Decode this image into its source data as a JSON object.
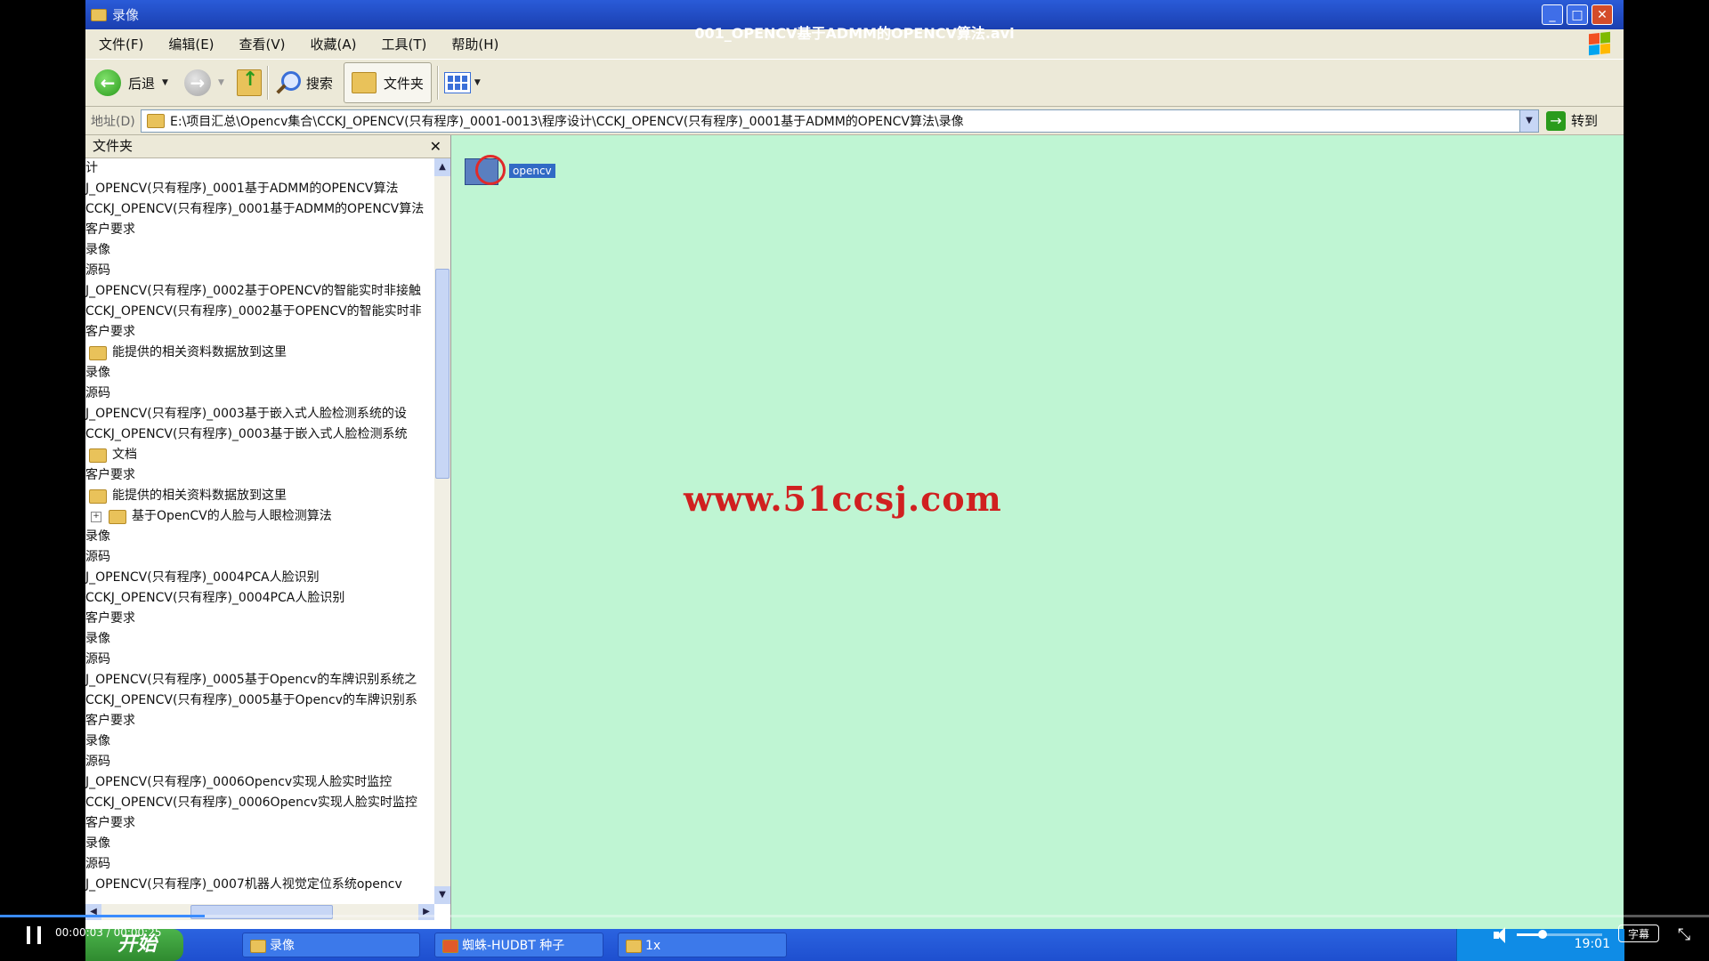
{
  "video": {
    "title": "001_OPENCV基于ADMM的OPENCV算法.avi",
    "current_time": "00:00:03",
    "duration": "00:00:25",
    "progress_fraction": 0.12,
    "volume_fraction": 0.3,
    "subtitle_label": "字幕"
  },
  "window": {
    "title": "录像",
    "min_glyph": "_",
    "max_glyph": "□",
    "close_glyph": "✕"
  },
  "menu": [
    "文件(F)",
    "编辑(E)",
    "查看(V)",
    "收藏(A)",
    "工具(T)",
    "帮助(H)"
  ],
  "toolbar": {
    "back_label": "后退",
    "search_label": "搜索",
    "folders_label": "文件夹"
  },
  "address": {
    "label": "地址(D)",
    "path": "E:\\项目汇总\\Opencv集合\\CCKJ_OPENCV(只有程序)_0001-0013\\程序设计\\CCKJ_OPENCV(只有程序)_0001基于ADMM的OPENCV算法\\录像",
    "go_label": "转到"
  },
  "folders_pane": {
    "title": "文件夹",
    "close_glyph": "✕",
    "items": [
      {
        "text": "计",
        "icon": "none"
      },
      {
        "text": "J_OPENCV(只有程序)_0001基于ADMM的OPENCV算法",
        "icon": "none"
      },
      {
        "text": "CCKJ_OPENCV(只有程序)_0001基于ADMM的OPENCV算法",
        "icon": "none"
      },
      {
        "text": "客户要求",
        "icon": "none"
      },
      {
        "text": "录像",
        "icon": "none"
      },
      {
        "text": "源码",
        "icon": "none"
      },
      {
        "text": "J_OPENCV(只有程序)_0002基于OPENCV的智能实时非接触",
        "icon": "none"
      },
      {
        "text": "CCKJ_OPENCV(只有程序)_0002基于OPENCV的智能实时非",
        "icon": "none"
      },
      {
        "text": "客户要求",
        "icon": "none"
      },
      {
        "text": "能提供的相关资料数据放到这里",
        "icon": "folder"
      },
      {
        "text": "录像",
        "icon": "none"
      },
      {
        "text": "源码",
        "icon": "none"
      },
      {
        "text": "J_OPENCV(只有程序)_0003基于嵌入式人脸检测系统的设",
        "icon": "none"
      },
      {
        "text": "CCKJ_OPENCV(只有程序)_0003基于嵌入式人脸检测系统",
        "icon": "none"
      },
      {
        "text": "文档",
        "icon": "folder"
      },
      {
        "text": "客户要求",
        "icon": "none"
      },
      {
        "text": "能提供的相关资料数据放到这里",
        "icon": "folder"
      },
      {
        "text": "基于OpenCV的人脸与人眼检测算法",
        "icon": "plus-folder"
      },
      {
        "text": "录像",
        "icon": "none"
      },
      {
        "text": "源码",
        "icon": "none"
      },
      {
        "text": "J_OPENCV(只有程序)_0004PCA人脸识别",
        "icon": "none"
      },
      {
        "text": "CCKJ_OPENCV(只有程序)_0004PCA人脸识别",
        "icon": "none"
      },
      {
        "text": "客户要求",
        "icon": "none"
      },
      {
        "text": "录像",
        "icon": "none"
      },
      {
        "text": "源码",
        "icon": "none"
      },
      {
        "text": "J_OPENCV(只有程序)_0005基于Opencv的车牌识别系统之",
        "icon": "none"
      },
      {
        "text": "CCKJ_OPENCV(只有程序)_0005基于Opencv的车牌识别系",
        "icon": "none"
      },
      {
        "text": "客户要求",
        "icon": "none"
      },
      {
        "text": "录像",
        "icon": "none"
      },
      {
        "text": "源码",
        "icon": "none"
      },
      {
        "text": "J_OPENCV(只有程序)_0006Opencv实现人脸实时监控",
        "icon": "none"
      },
      {
        "text": "CCKJ_OPENCV(只有程序)_0006Opencv实现人脸实时监控",
        "icon": "none"
      },
      {
        "text": "客户要求",
        "icon": "none"
      },
      {
        "text": "录像",
        "icon": "none"
      },
      {
        "text": "源码",
        "icon": "none"
      },
      {
        "text": "J_OPENCV(只有程序)_0007机器人视觉定位系统opencv",
        "icon": "none"
      }
    ]
  },
  "file": {
    "name": "opencv"
  },
  "watermark": "www.51ccsj.com",
  "taskbar": {
    "start_label": "开始",
    "tasks": [
      "录像",
      "蜘蛛-HUDBT 种子",
      "1x"
    ],
    "clock": "19:01"
  },
  "colors": {
    "desktop_bg": "#bff5d3",
    "titlebar": "#2a5bd8",
    "watermark": "#d02020",
    "progress": "#3a8cff"
  }
}
